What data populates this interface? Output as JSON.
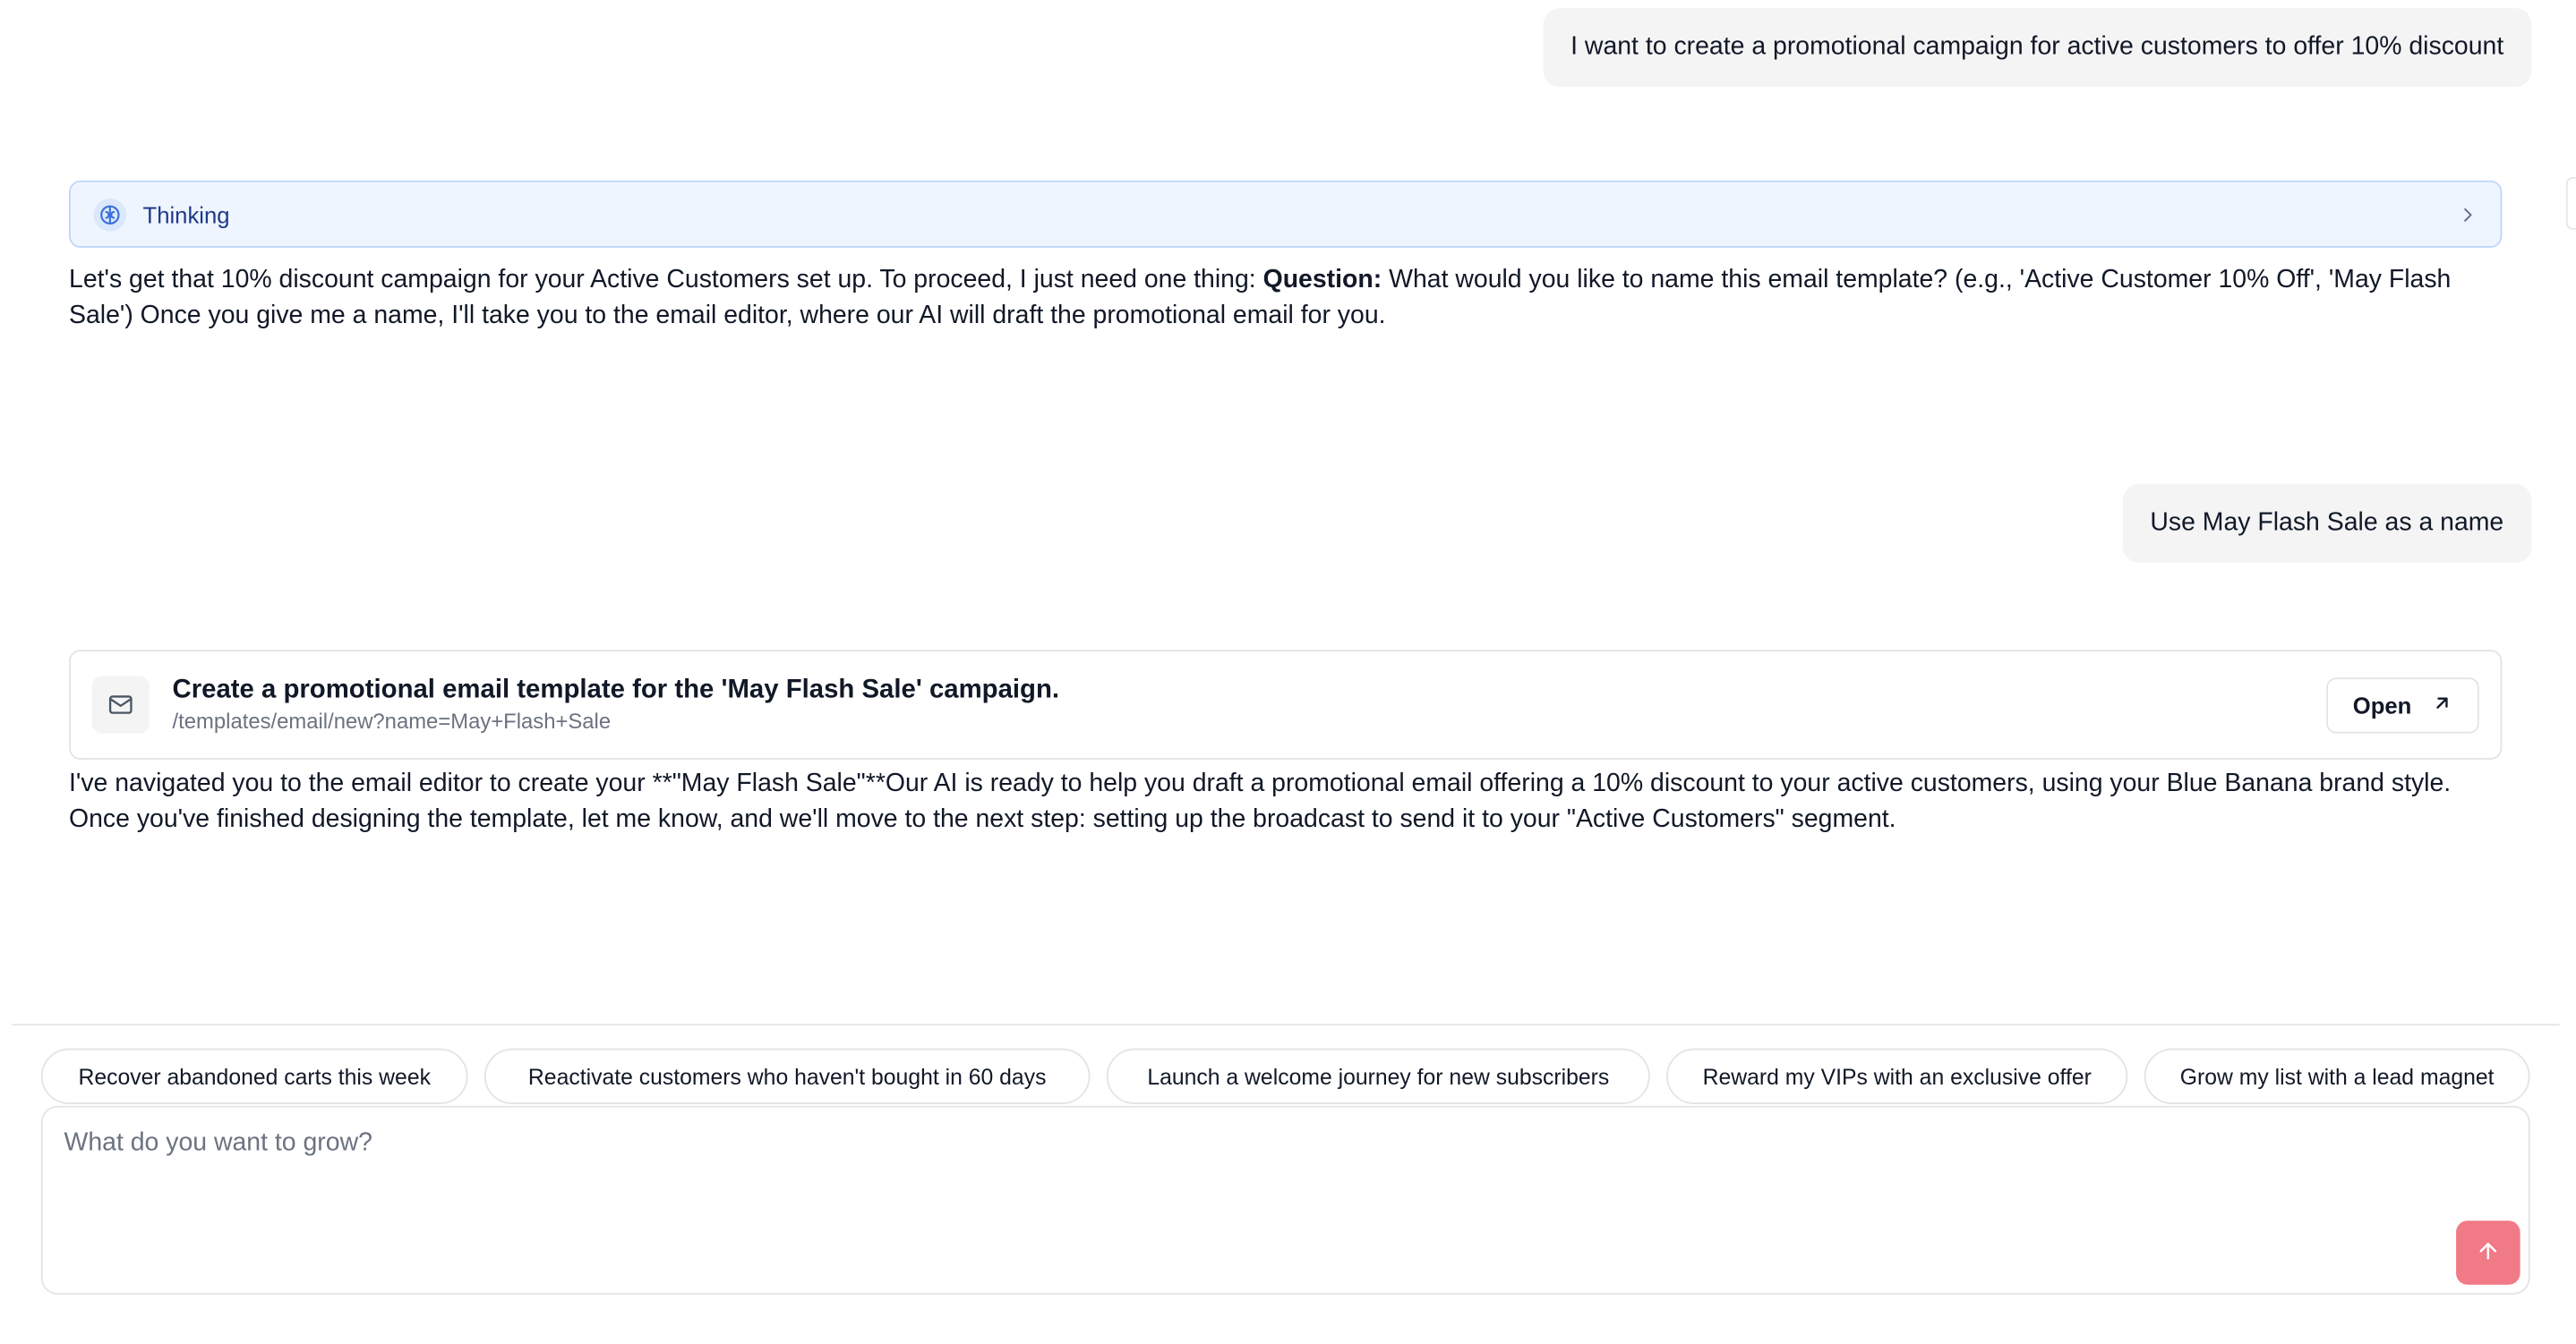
{
  "conversation": {
    "user_message_1": "I want to create a promotional campaign for active customers to offer 10% discount",
    "thinking_label": "Thinking",
    "assistant_message_1": {
      "before": "Let's get that 10% discount campaign for your Active Customers set up. To proceed, I just need one thing: ",
      "bold": "Question:",
      "after": " What would you like to name this email template? (e.g., 'Active Customer 10% Off', 'May Flash Sale') Once you give me a name, I'll take you to the email editor, where our AI will draft the promotional email for you."
    },
    "user_message_2": "Use May Flash Sale as a name",
    "action_card": {
      "title": "Create a promotional email template for the 'May Flash Sale' campaign.",
      "path": "/templates/email/new?name=May+Flash+Sale",
      "open_label": "Open"
    },
    "assistant_message_2": {
      "line1": "I've navigated you to the email editor to create your **\"May Flash Sale\"**Our AI is ready to help you draft a promotional email offering a 10% discount to your active customers, using your Blue Banana brand style.",
      "line2": "Once you've finished designing the template, let me know, and we'll move to the next step: setting up the broadcast to send it to your \"Active Customers\" segment."
    }
  },
  "suggestions": [
    "Recover abandoned carts this week",
    "Reactivate customers who haven't bought in 60 days",
    "Launch a welcome journey for new subscribers",
    "Reward my VIPs with an exclusive offer",
    "Grow my list with a lead magnet"
  ],
  "composer": {
    "placeholder": "What do you want to grow?",
    "value": ""
  },
  "icons": {
    "thinking": "brain-icon",
    "thinking_expand": "chevron-right-icon",
    "action": "mail-icon",
    "open": "arrow-up-right-icon",
    "send": "arrow-up-icon"
  },
  "colors": {
    "thinking_bg": "#eff5ff",
    "thinking_border": "#bfd6fb",
    "thinking_text": "#1e3a8a",
    "send_button": "#f07a86",
    "user_bubble": "#f4f4f5"
  }
}
